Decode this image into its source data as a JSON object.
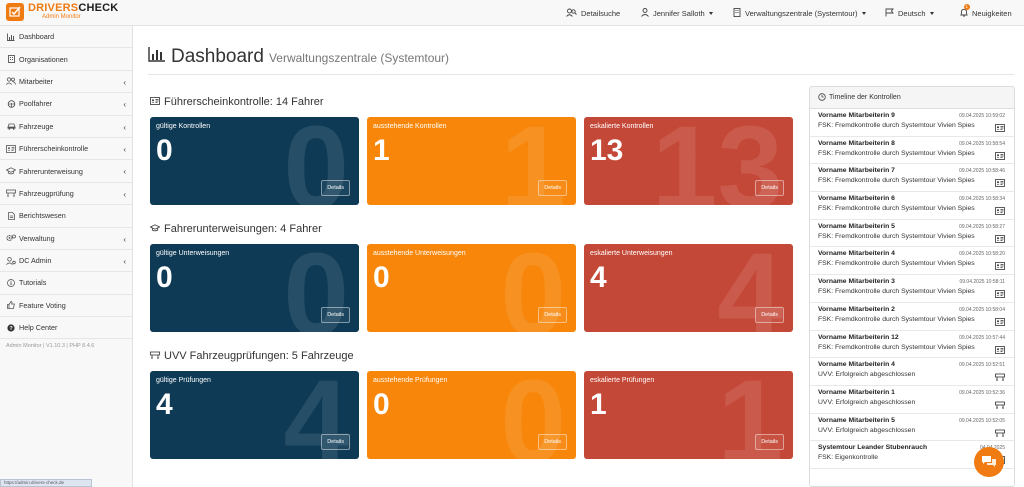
{
  "app": {
    "logo_title_a": "DRIVERS",
    "logo_title_b": "CHECK",
    "logo_sub": "Admin Monitor"
  },
  "topnav": {
    "search_label": "Detailsuche",
    "user_label": "Jennifer Salloth",
    "org_label": "Verwaltungszentrale (Systemtour)",
    "lang_label": "Deutsch",
    "news_label": "Neuigkeiten",
    "news_badge": "1"
  },
  "sidebar": {
    "items": [
      {
        "label": "Dashboard",
        "icon": "chart-icon",
        "has_sub": false
      },
      {
        "label": "Organisationen",
        "icon": "building-icon",
        "has_sub": false
      },
      {
        "label": "Mitarbeiter",
        "icon": "users-icon",
        "has_sub": true
      },
      {
        "label": "Poolfahrer",
        "icon": "driver-icon",
        "has_sub": true
      },
      {
        "label": "Fahrzeuge",
        "icon": "car-icon",
        "has_sub": true
      },
      {
        "label": "Führerscheinkontrolle",
        "icon": "id-card-icon",
        "has_sub": true
      },
      {
        "label": "Fahrerunterweisung",
        "icon": "graduation-icon",
        "has_sub": true
      },
      {
        "label": "Fahrzeugprüfung",
        "icon": "truck-icon",
        "has_sub": true
      },
      {
        "label": "Berichtswesen",
        "icon": "report-icon",
        "has_sub": false
      },
      {
        "label": "Verwaltung",
        "icon": "cogs-icon",
        "has_sub": true
      },
      {
        "label": "DC Admin",
        "icon": "admin-icon",
        "has_sub": true
      },
      {
        "label": "Tutorials",
        "icon": "info-icon",
        "has_sub": false
      },
      {
        "label": "Feature Voting",
        "icon": "thumbs-up-icon",
        "has_sub": false
      },
      {
        "label": "Help Center",
        "icon": "help-icon",
        "has_sub": false
      }
    ],
    "version": "Admin Monitor | V1.10.3 | PHP 8.4.6",
    "status_url": "https://admin.drivers-check.de"
  },
  "header": {
    "title": "Dashboard",
    "subtitle": "Verwaltungszentrale (Systemtour)"
  },
  "sections": [
    {
      "title": "Führerscheinkontrolle: 14 Fahrer",
      "icon": "id-card-icon",
      "cards": [
        {
          "label": "gültige Kontrollen",
          "value": "0",
          "style": "dark",
          "button": "Details"
        },
        {
          "label": "ausstehende Kontrollen",
          "value": "1",
          "style": "orange",
          "button": "Details"
        },
        {
          "label": "eskalierte Kontrollen",
          "value": "13",
          "style": "red",
          "button": "Details"
        }
      ]
    },
    {
      "title": "Fahrerunterweisungen: 4 Fahrer",
      "icon": "graduation-icon",
      "cards": [
        {
          "label": "gültige Unterweisungen",
          "value": "0",
          "style": "dark",
          "button": "Details"
        },
        {
          "label": "ausstehende Unterweisungen",
          "value": "0",
          "style": "orange",
          "button": "Details"
        },
        {
          "label": "eskalierte Unterweisungen",
          "value": "4",
          "style": "red",
          "button": "Details"
        }
      ]
    },
    {
      "title": "UVV Fahrzeugprüfungen: 5 Fahrzeuge",
      "icon": "truck-icon",
      "cards": [
        {
          "label": "gültige Prüfungen",
          "value": "4",
          "style": "dark",
          "button": "Details"
        },
        {
          "label": "ausstehende Prüfungen",
          "value": "0",
          "style": "orange",
          "button": "Details"
        },
        {
          "label": "eskalierte Prüfungen",
          "value": "1",
          "style": "red",
          "button": "Details"
        }
      ]
    }
  ],
  "timeline": {
    "title": "Timeline der Kontrollen",
    "items": [
      {
        "name": "Vorname Mitarbeiterin 9",
        "time": "09.04.2025 10:59:02",
        "desc": "FSK: Fremdkontrolle durch Systemtour Vivien Spies",
        "icon": "id-card-icon"
      },
      {
        "name": "Vorname Mitarbeiterin 8",
        "time": "09.04.2025 10:58:54",
        "desc": "FSK: Fremdkontrolle durch Systemtour Vivien Spies",
        "icon": "id-card-icon"
      },
      {
        "name": "Vorname Mitarbeiterin 7",
        "time": "09.04.2025 10:58:46",
        "desc": "FSK: Fremdkontrolle durch Systemtour Vivien Spies",
        "icon": "id-card-icon"
      },
      {
        "name": "Vorname Mitarbeiterin 6",
        "time": "09.04.2025 10:58:34",
        "desc": "FSK: Fremdkontrolle durch Systemtour Vivien Spies",
        "icon": "id-card-icon"
      },
      {
        "name": "Vorname Mitarbeiterin 5",
        "time": "09.04.2025 10:58:27",
        "desc": "FSK: Fremdkontrolle durch Systemtour Vivien Spies",
        "icon": "id-card-icon"
      },
      {
        "name": "Vorname Mitarbeiterin 4",
        "time": "09.04.2025 10:58:20",
        "desc": "FSK: Fremdkontrolle durch Systemtour Vivien Spies",
        "icon": "id-card-icon"
      },
      {
        "name": "Vorname Mitarbeiterin 3",
        "time": "09.04.2025 10:58:11",
        "desc": "FSK: Fremdkontrolle durch Systemtour Vivien Spies",
        "icon": "id-card-icon"
      },
      {
        "name": "Vorname Mitarbeiterin 2",
        "time": "09.04.2025 10:58:04",
        "desc": "FSK: Fremdkontrolle durch Systemtour Vivien Spies",
        "icon": "id-card-icon"
      },
      {
        "name": "Vorname Mitarbeiterin 12",
        "time": "09.04.2025 10:57:44",
        "desc": "FSK: Fremdkontrolle durch Systemtour Vivien Spies",
        "icon": "id-card-icon"
      },
      {
        "name": "Vorname Mitarbeiterin 4",
        "time": "09.04.2025 10:52:51",
        "desc": "UVV: Erfolgreich abgeschlossen",
        "icon": "truck-icon"
      },
      {
        "name": "Vorname Mitarbeiterin 1",
        "time": "09.04.2025 10:52:36",
        "desc": "UVV: Erfolgreich abgeschlossen",
        "icon": "truck-icon"
      },
      {
        "name": "Vorname Mitarbeiterin 5",
        "time": "09.04.2025 10:52:05",
        "desc": "UVV: Erfolgreich abgeschlossen",
        "icon": "truck-icon"
      },
      {
        "name": "Systemtour Leander Stubenrauch",
        "time": "04.04.2025",
        "desc": "FSK: Eigenkontrolle",
        "icon": "id-card-icon"
      }
    ]
  },
  "colors": {
    "brand": "#f07b12",
    "card_dark": "#0e3a55",
    "card_orange": "#f7860a",
    "card_red": "#c44837"
  }
}
